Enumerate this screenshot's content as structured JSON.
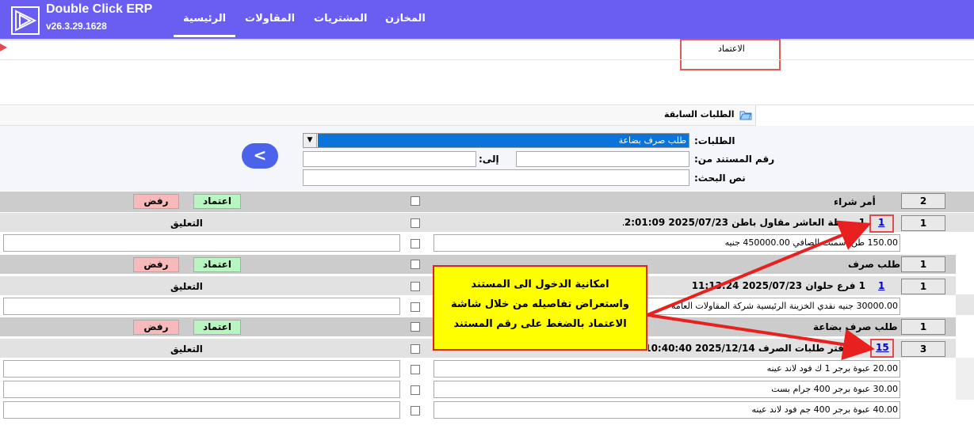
{
  "app": {
    "brand": "Double Click ERP",
    "version": "v26.3.29.1628"
  },
  "nav": {
    "items": [
      {
        "label": "الرئيسية",
        "active": true
      },
      {
        "label": "المقاولات"
      },
      {
        "label": "المشتريات"
      },
      {
        "label": "المخازن"
      }
    ]
  },
  "page": {
    "section_label": "الاعتماد",
    "tab_title": "الطلبات السابقة"
  },
  "filters": {
    "requests_label": "الطلبات:",
    "requests_selected": "طلب صرف بضاعة",
    "doc_from_label": "رقم المستند من:",
    "to_label": "إلى:",
    "search_label": "نص البحث:"
  },
  "actions": {
    "approve": "اعتماد",
    "reject": "رفض",
    "comment": "التعليق"
  },
  "groups": [
    {
      "title": "أمر شراء",
      "count": "2",
      "docs": [
        {
          "index": "1",
          "doc_no": "1",
          "header": "1 محطة العاشر  مقاول باطن 2025/07/23 12:01:09",
          "lines": [
            "150.00  طن اسمنت  الصافي 450000.00  جنيه"
          ]
        }
      ]
    },
    {
      "title": "طلب صرف",
      "count": "1",
      "docs": [
        {
          "index": "1",
          "doc_no": "1",
          "header": "1 فرع حلوان  2025/07/23 11:13:24",
          "lines": [
            "30000.00  جنيه نقدي الخزينة الرئيسية   شركة المقاولات العامة"
          ]
        }
      ]
    },
    {
      "title": "طلب صرف بضاعة",
      "count": "1",
      "docs": [
        {
          "index": "3",
          "doc_no": "15",
          "header": "15 دفتر طلبات الصرف 2025/12/14 10:40:40",
          "lines": [
            "20.00 عبوة  برجر 1 ك فود لاند عينه",
            "30.00 عبوة  برجر 400 جرام بست",
            "40.00 عبوة  برجر 400 جم فود لاند عينه"
          ]
        }
      ]
    }
  ],
  "callout": {
    "line1": "امكانية الدخول الى المستند",
    "line2": "واستعراض تفاصيله من خلال شاشة",
    "line3": "الاعتماد بالضغط على رقم المستند"
  },
  "colors": {
    "topbar": "#6a5df1",
    "approve": "#b7f6c0",
    "reject": "#f7b9b9",
    "callout": "#ffff00",
    "annotation": "#e24b4b"
  }
}
